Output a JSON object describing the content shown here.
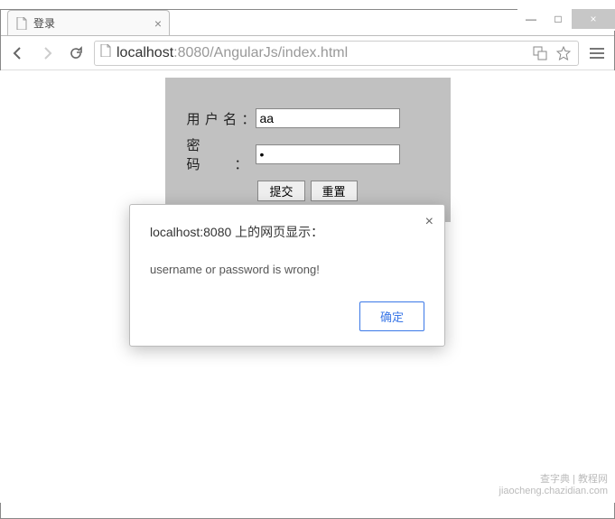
{
  "window": {
    "minimize": "—",
    "maximize": "□",
    "close": "×"
  },
  "tab": {
    "title": "登录",
    "close": "×"
  },
  "toolbar": {
    "url_prefix": "",
    "url_host": "localhost",
    "url_rest": ":8080/AngularJs/index.html"
  },
  "form": {
    "username_label": "用户名：",
    "password_label": "密 码：",
    "username_value": "aa",
    "password_value": "•",
    "submit_label": "提交",
    "reset_label": "重置"
  },
  "dialog": {
    "title": "localhost:8080 上的网页显示：",
    "message": "username or password is wrong!",
    "ok_label": "确定",
    "close": "×"
  },
  "watermark": {
    "line1": "查字典 | 教程网",
    "line2": "jiaocheng.chazidian.com"
  }
}
